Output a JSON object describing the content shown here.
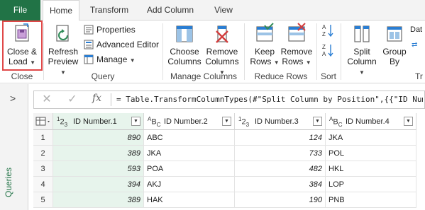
{
  "tabs": {
    "file": "File",
    "home": "Home",
    "transform": "Transform",
    "add_column": "Add Column",
    "view": "View"
  },
  "ribbon": {
    "close_group": {
      "label": "Close",
      "close_load": "Close &",
      "close_load_2": "Load"
    },
    "query_group": {
      "label": "Query",
      "refresh_preview": "Refresh",
      "refresh_preview_2": "Preview",
      "properties": "Properties",
      "advanced_editor": "Advanced Editor",
      "manage": "Manage"
    },
    "manage_columns_group": {
      "label": "Manage Columns",
      "choose_columns": "Choose",
      "choose_columns_2": "Columns",
      "remove_columns": "Remove",
      "remove_columns_2": "Columns"
    },
    "reduce_rows_group": {
      "label": "Reduce Rows",
      "keep_rows": "Keep",
      "keep_rows_2": "Rows",
      "remove_rows": "Remove",
      "remove_rows_2": "Rows"
    },
    "sort_group": {
      "label": "Sort"
    },
    "transform_group": {
      "split_column": "Split",
      "split_column_2": "Column",
      "group_by": "Group",
      "group_by_2": "By",
      "data_type_partial": "Dat",
      "partial_label": "Tr"
    }
  },
  "queries_pane": {
    "label": "Queries"
  },
  "formula_bar": {
    "cancel": "✕",
    "confirm": "✓",
    "fx": "fx",
    "formula": "= Table.TransformColumnTypes(#\"Split Column by Position\",{{\"ID Num"
  },
  "grid": {
    "columns": [
      {
        "type_icon": "123",
        "name": "ID Number.1"
      },
      {
        "type_icon": "ABC",
        "name": "ID Number.2"
      },
      {
        "type_icon": "123",
        "name": "ID Number.3"
      },
      {
        "type_icon": "ABC",
        "name": "ID Number.4"
      }
    ],
    "rows": [
      {
        "n": "1",
        "c1": "890",
        "c2": "ABC",
        "c3": "124",
        "c4": "JKA"
      },
      {
        "n": "2",
        "c1": "389",
        "c2": "JKA",
        "c3": "733",
        "c4": "POL"
      },
      {
        "n": "3",
        "c1": "593",
        "c2": "POA",
        "c3": "482",
        "c4": "HKL"
      },
      {
        "n": "4",
        "c1": "394",
        "c2": "AKJ",
        "c3": "384",
        "c4": "LOP"
      },
      {
        "n": "5",
        "c1": "389",
        "c2": "HAK",
        "c3": "190",
        "c4": "PNB"
      }
    ]
  },
  "colors": {
    "file_tab": "#217346",
    "highlight_box": "#e04848",
    "selected_column": "#e7f4ec"
  }
}
